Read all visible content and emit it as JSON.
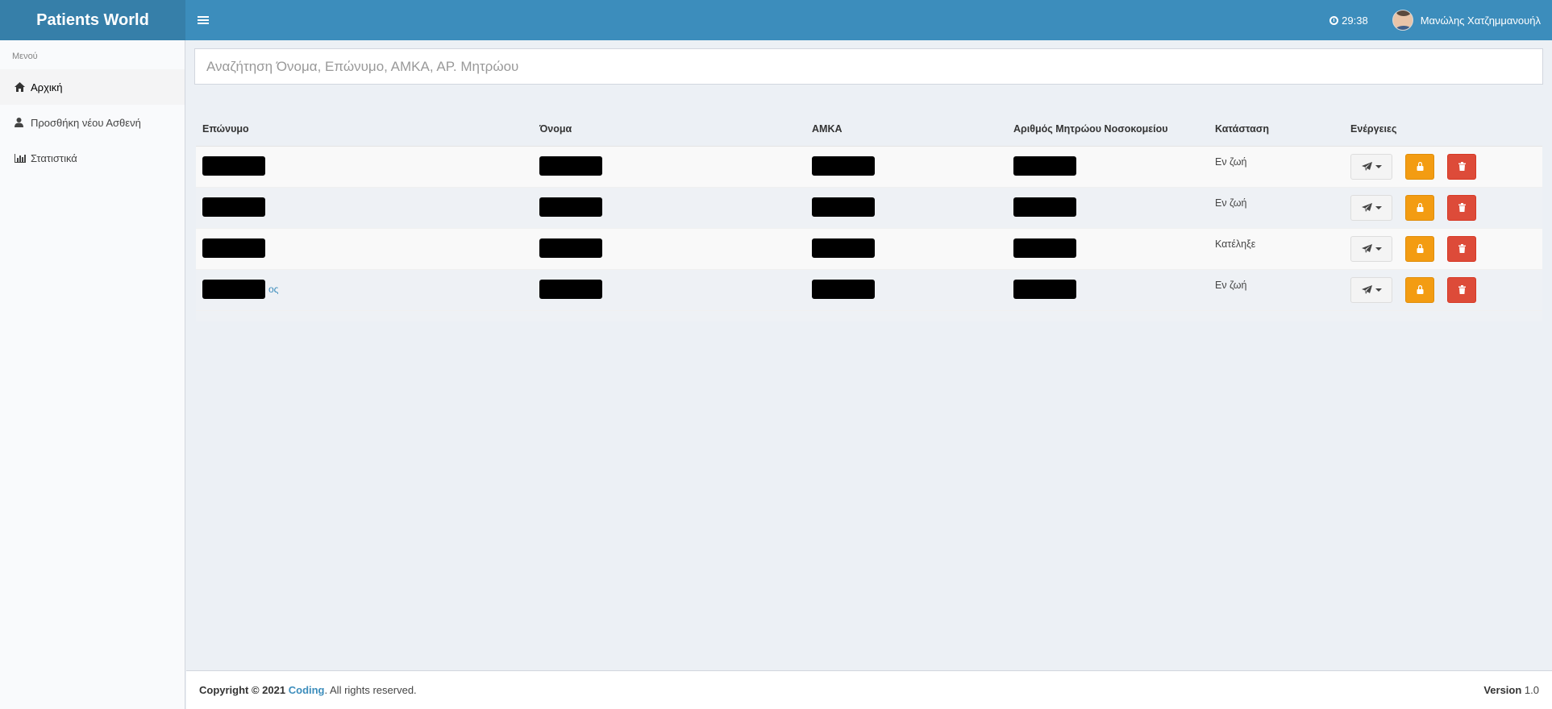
{
  "header": {
    "brand": "Patients World",
    "clock": "29:38",
    "user_name": "Μανώλης Χατζημμανουήλ"
  },
  "sidebar": {
    "title": "Μενού",
    "items": [
      {
        "label": "Αρχική",
        "icon": "home-icon",
        "active": true
      },
      {
        "label": "Προσθήκη νέου Ασθενή",
        "icon": "user-icon",
        "active": false
      },
      {
        "label": "Στατιστικά",
        "icon": "bar-chart-icon",
        "active": false
      }
    ]
  },
  "search": {
    "placeholder": "Αναζήτηση Όνομα, Επώνυμο, ΑΜΚΑ, ΑΡ. Μητρώου",
    "value": ""
  },
  "table": {
    "headers": [
      "Επώνυμο",
      "Όνομα",
      "ΑΜΚΑ",
      "Αριθμός Μητρώου Νοσοκομείου",
      "Κατάσταση",
      "Ενέργειες"
    ],
    "rows": [
      {
        "surname_suffix": "",
        "status": "Εν ζωή"
      },
      {
        "surname_suffix": "",
        "status": "Εν ζωή"
      },
      {
        "surname_suffix": "",
        "status": "Κατέληξε"
      },
      {
        "surname_suffix": "ος",
        "status": "Εν ζωή"
      }
    ]
  },
  "footer": {
    "copyright_prefix": "Copyright © 2021",
    "company": "Coding",
    "rights": ". All rights reserved.",
    "version_label": "Version",
    "version_number": "1.0"
  },
  "colors": {
    "header": "#3c8dbc",
    "brand": "#367fa9",
    "lock_button": "#f39c12",
    "delete_button": "#dd4b39"
  }
}
